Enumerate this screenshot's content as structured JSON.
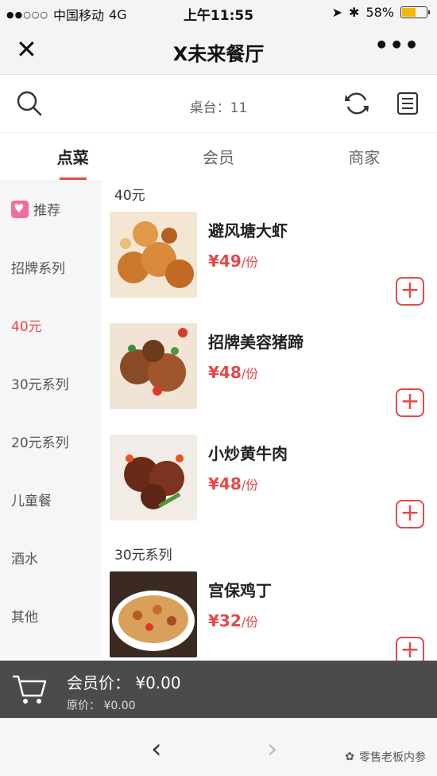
{
  "status_bar": {
    "carrier": "中国移动",
    "network": "4G",
    "time": "上午11:55",
    "battery_percent": "58%",
    "battery_level": 0.58
  },
  "title_bar": {
    "title": "X未来餐厅",
    "close_label": "✕",
    "more_label": "•••"
  },
  "toolbar": {
    "table_label": "桌台：11"
  },
  "tabs": [
    {
      "label": "点菜",
      "active": true
    },
    {
      "label": "会员",
      "active": false
    },
    {
      "label": "商家",
      "active": false
    }
  ],
  "sidebar": {
    "items": [
      {
        "label": "推荐",
        "active": false
      },
      {
        "label": "招牌系列",
        "active": false
      },
      {
        "label": "40元",
        "active": true
      },
      {
        "label": "30元系列",
        "active": false
      },
      {
        "label": "20元系列",
        "active": false
      },
      {
        "label": "儿童餐",
        "active": false
      },
      {
        "label": "酒水",
        "active": false
      },
      {
        "label": "其他",
        "active": false
      }
    ]
  },
  "sections": [
    {
      "title": "40元",
      "dishes": [
        {
          "name": "避风塘大虾",
          "price": "¥49",
          "unit": "/份"
        },
        {
          "name": "招牌美容猪蹄",
          "price": "¥48",
          "unit": "/份"
        },
        {
          "name": "小炒黄牛肉",
          "price": "¥48",
          "unit": "/份"
        }
      ]
    },
    {
      "title": "30元系列",
      "dishes": [
        {
          "name": "宫保鸡丁",
          "price": "¥32",
          "unit": "/份"
        }
      ]
    }
  ],
  "cart": {
    "member_price": "会员价：  ¥0.00",
    "original_price": "原价：  ¥0.00"
  },
  "bottom_nav": {
    "back_label": "‹",
    "forward_label": "›",
    "watermark": "零售老板内参"
  },
  "colors": {
    "accent": "#e34a4a",
    "recommend_badge": "#f06da0"
  }
}
